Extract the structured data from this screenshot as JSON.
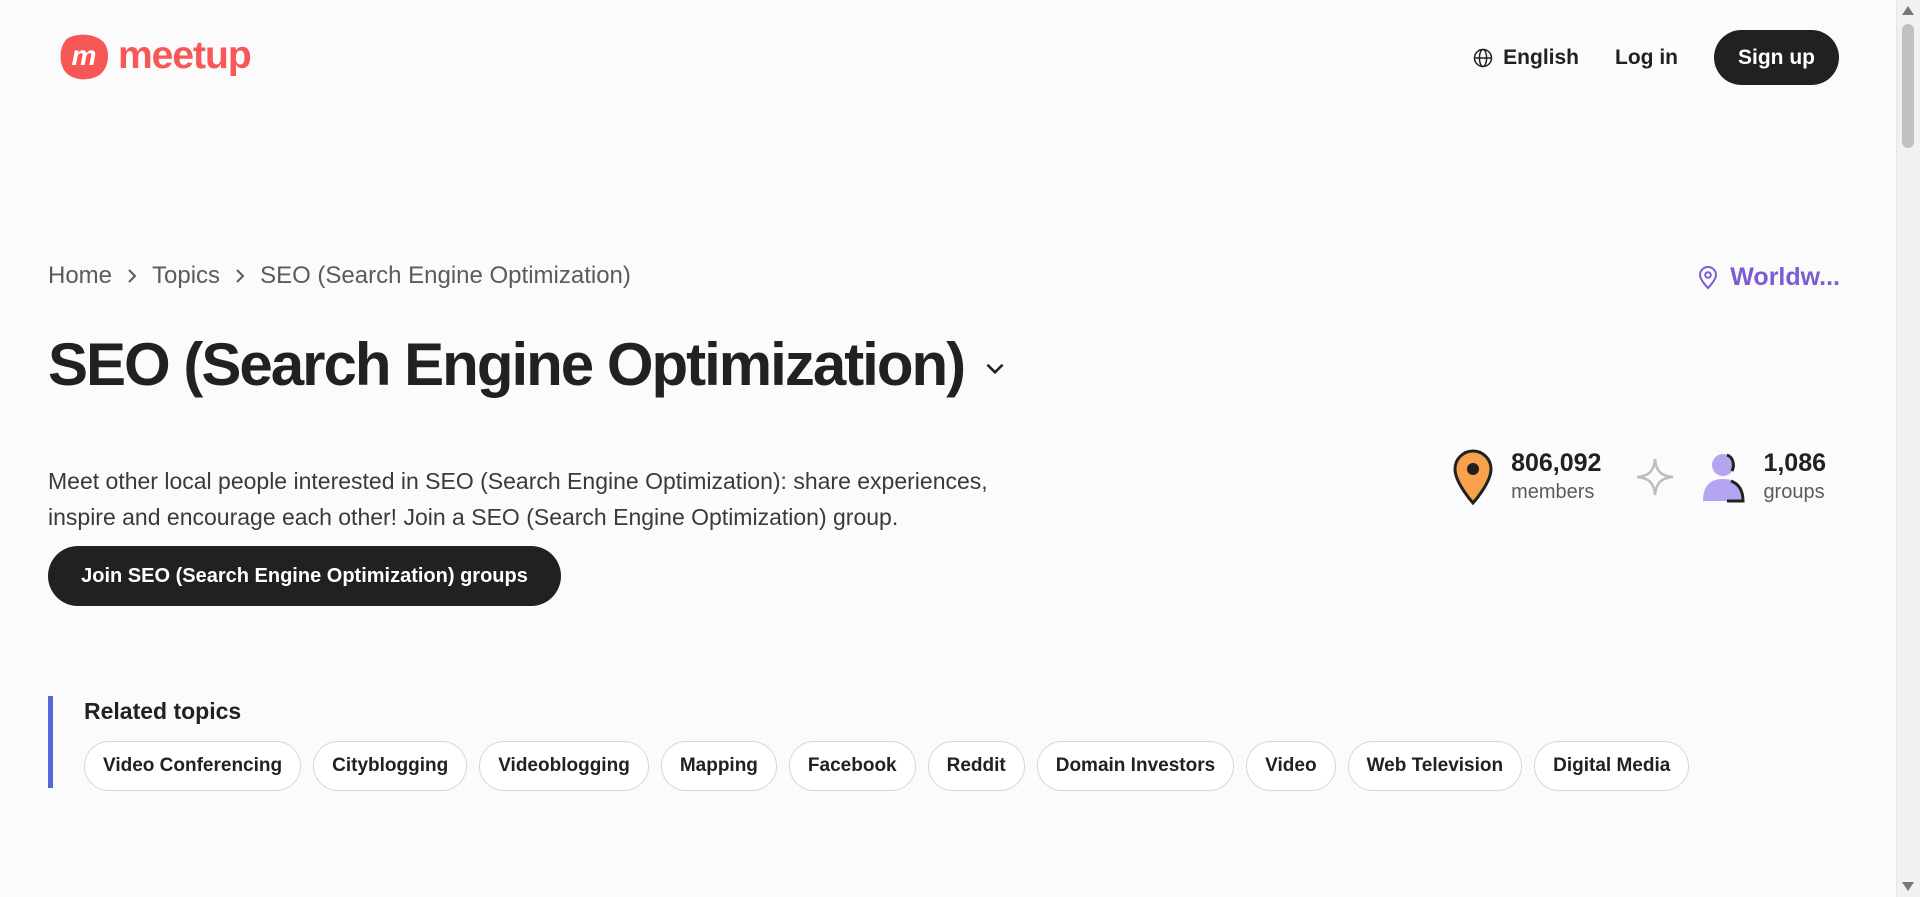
{
  "header": {
    "logo_text": "meetup",
    "language": "English",
    "login": "Log in",
    "signup": "Sign up"
  },
  "breadcrumb": {
    "items": [
      "Home",
      "Topics",
      "SEO (Search Engine Optimization)"
    ]
  },
  "location": {
    "label": "Worldw..."
  },
  "topic": {
    "title": "SEO (Search Engine Optimization)",
    "description": "Meet other local people interested in SEO (Search Engine Optimization): share experiences, inspire and encourage each other! Join a SEO (Search Engine Optimization) group.",
    "join_button": "Join SEO (Search Engine Optimization) groups"
  },
  "stats": {
    "members_count": "806,092",
    "members_label": "members",
    "groups_count": "1,086",
    "groups_label": "groups"
  },
  "related": {
    "title": "Related topics",
    "topics": [
      "Video Conferencing",
      "Cityblogging",
      "Videoblogging",
      "Mapping",
      "Facebook",
      "Reddit",
      "Domain Investors",
      "Video",
      "Web Television",
      "Digital Media"
    ]
  },
  "colors": {
    "brand": "#f65858",
    "accent": "#7e5bd1",
    "dark": "#212121",
    "related_bar": "#5466d8"
  },
  "icons": [
    "globe-icon",
    "chevron-right-icon",
    "map-pin-icon",
    "chevron-down-icon",
    "location-pin-icon",
    "sparkle-icon",
    "person-icon"
  ]
}
